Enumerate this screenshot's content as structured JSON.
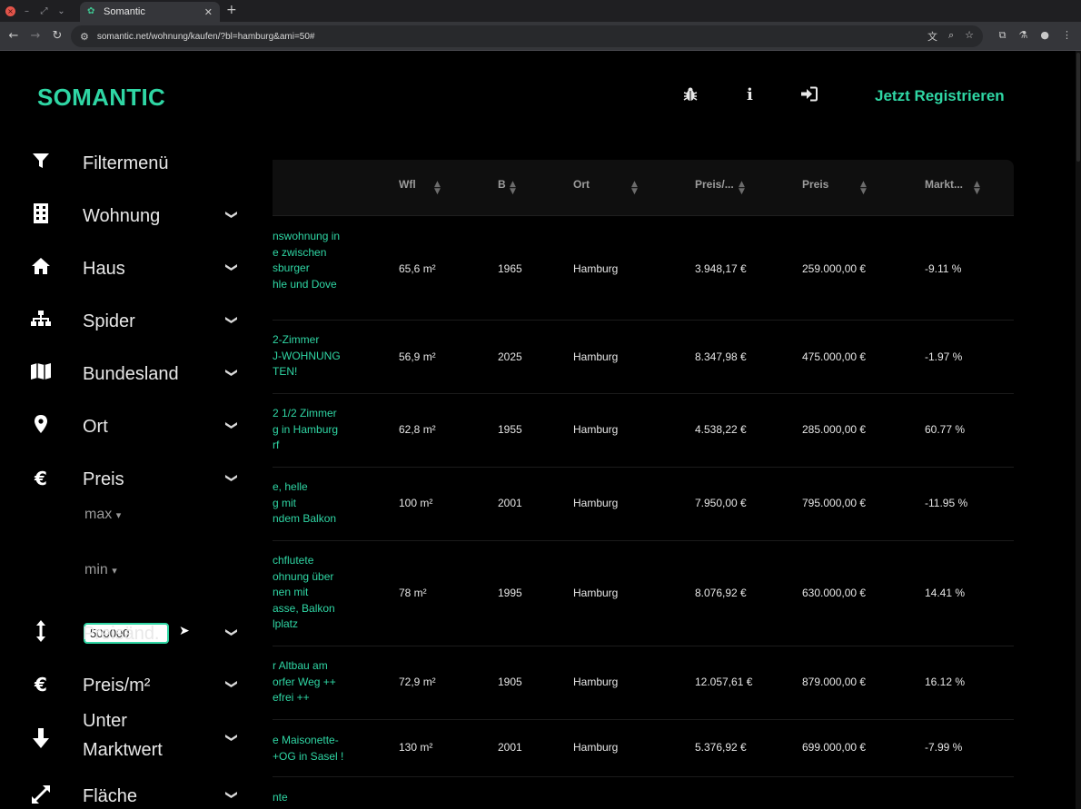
{
  "browser": {
    "tab_title": "Somantic",
    "url": "somantic.net/wohnung/kaufen/?bl=hamburg&ami=50#"
  },
  "header": {
    "logo": "SOMANTIC",
    "register_label": "Jetzt Registrieren",
    "icons": [
      "bug-icon",
      "info-icon",
      "sign-in-icon"
    ]
  },
  "sidebar": {
    "items": [
      {
        "label": "Filtermenü",
        "icon": "filter-icon"
      },
      {
        "label": "Wohnung",
        "icon": "building-icon"
      },
      {
        "label": "Haus",
        "icon": "house-icon"
      },
      {
        "label": "Spider",
        "icon": "sitemap-icon"
      },
      {
        "label": "Bundesland",
        "icon": "map-icon"
      },
      {
        "label": "Ort",
        "icon": "location-pin-icon"
      },
      {
        "label": "Preis",
        "icon": "euro-icon"
      },
      {
        "label": "Preisänd.",
        "icon": "arrows-vertical-icon"
      },
      {
        "label": "Preis/m²",
        "icon": "euro-icon"
      },
      {
        "label": "Unter",
        "label2": "Marktwert",
        "icon": "arrow-down-icon"
      },
      {
        "label": "Fläche",
        "icon": "expand-icon"
      }
    ],
    "price_filter": {
      "max_label": "max",
      "max_value": "500000",
      "min_label": "min"
    }
  },
  "table": {
    "headers": [
      "Wfl",
      "B",
      "Ort",
      "Preis/...",
      "Preis",
      "Markt..."
    ],
    "rows": [
      {
        "title": "nswohnung in\ne zwischen\nsburger\nhle und Dove",
        "wfl": "65,6 m²",
        "b": "1965",
        "ort": "Hamburg",
        "ppm": "3.948,17 €",
        "preis": "259.000,00 €",
        "markt": "-9.11 %"
      },
      {
        "title": "2-Zimmer\nJ-WOHNUNG\nTEN!",
        "wfl": "56,9 m²",
        "b": "2025",
        "ort": "Hamburg",
        "ppm": "8.347,98 €",
        "preis": "475.000,00 €",
        "markt": "-1.97 %"
      },
      {
        "title": "2 1/2 Zimmer\ng in Hamburg\nrf",
        "wfl": "62,8 m²",
        "b": "1955",
        "ort": "Hamburg",
        "ppm": "4.538,22 €",
        "preis": "285.000,00 €",
        "markt": "60.77 %"
      },
      {
        "title": "e, helle\ng mit\nndem Balkon",
        "wfl": "100 m²",
        "b": "2001",
        "ort": "Hamburg",
        "ppm": "7.950,00 €",
        "preis": "795.000,00 €",
        "markt": "-11.95 %"
      },
      {
        "title": "chflutete\nohnung über\nnen mit\nasse, Balkon\nlplatz",
        "wfl": "78 m²",
        "b": "1995",
        "ort": "Hamburg",
        "ppm": "8.076,92 €",
        "preis": "630.000,00 €",
        "markt": "14.41 %"
      },
      {
        "title": "r Altbau am\norfer Weg ++\nefrei ++",
        "wfl": "72,9 m²",
        "b": "1905",
        "ort": "Hamburg",
        "ppm": "12.057,61 €",
        "preis": "879.000,00 €",
        "markt": "16.12 %"
      },
      {
        "title": "e Maisonette-\n+OG in Sasel !",
        "wfl": "130 m²",
        "b": "2001",
        "ort": "Hamburg",
        "ppm": "5.376,92 €",
        "preis": "699.000,00 €",
        "markt": "-7.99 %"
      },
      {
        "title": "nte",
        "wfl": "",
        "b": "",
        "ort": "",
        "ppm": "",
        "preis": "",
        "markt": ""
      }
    ]
  },
  "colors": {
    "accent": "#2fd6a4",
    "background": "#000000"
  }
}
